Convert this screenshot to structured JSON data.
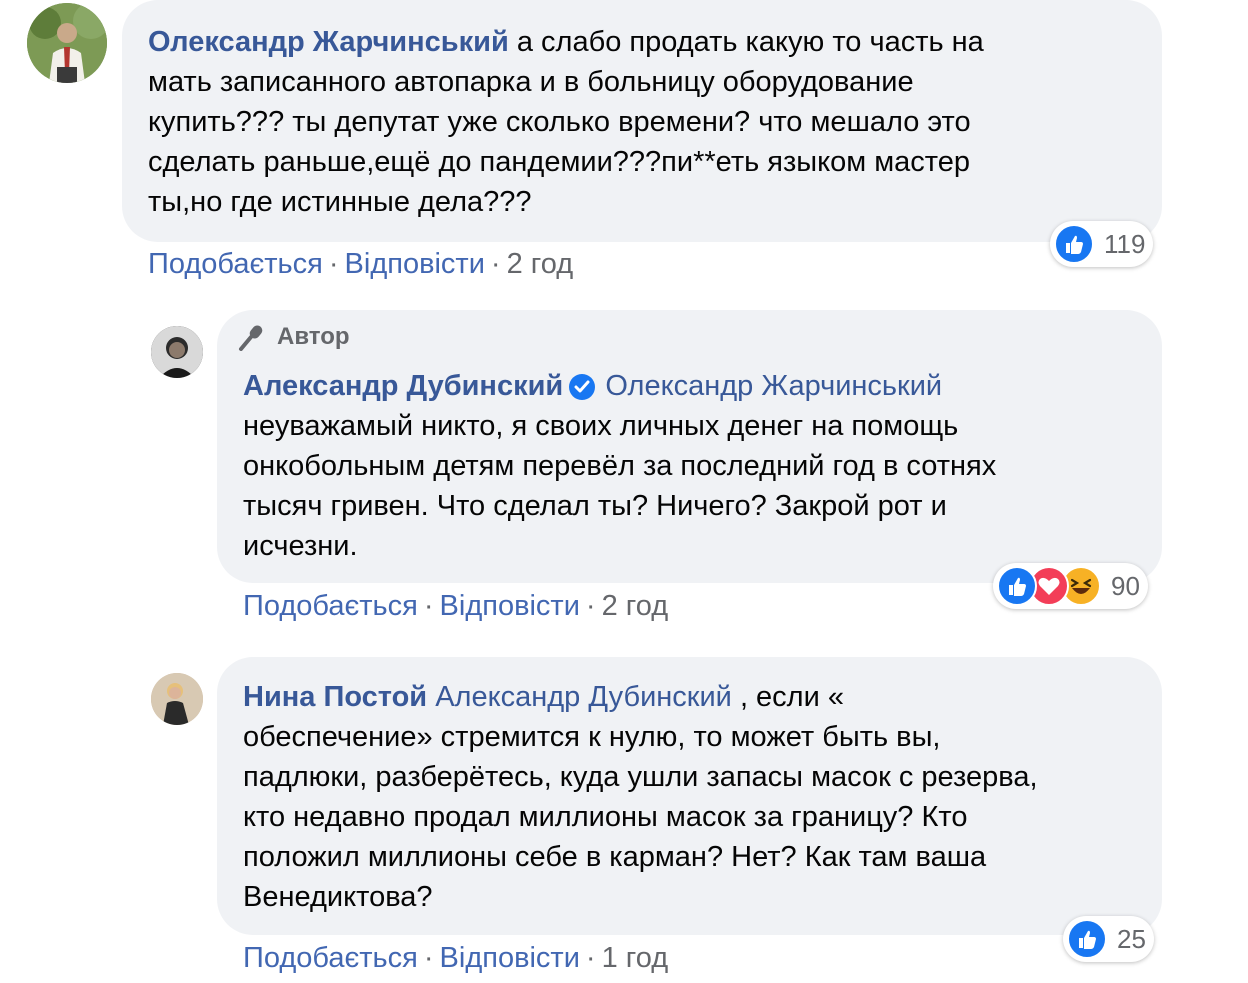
{
  "comments": [
    {
      "author": "Олександр Жарчинський",
      "line1_rest": "а слабо продать какую то часть на",
      "lines": [
        "мать записанного автопарка и в больницу оборудование",
        "купить??? ты депутат уже сколько времени? что мешало это",
        "сделать раньше,ещё до пандемии???пи**еть языком мастер",
        "ты,но где истинные дела???"
      ],
      "like_label": "Подобається",
      "reply_label": "Відповісти",
      "time": "2 год",
      "reaction_count": "119"
    },
    {
      "badge": "Автор",
      "author": "Александр Дубинский",
      "mention": "Олександр Жарчинський",
      "lines": [
        "неуважамый никто, я своих личных денег на помощь",
        "онкобольным детям перевёл за последний год в сотнях",
        "тысяч гривен. Что сделал ты? Ничего? Закрой рот и",
        "исчезни."
      ],
      "like_label": "Подобається",
      "reply_label": "Відповісти",
      "time": "2 год",
      "reaction_count": "90"
    },
    {
      "author": "Нина Постой",
      "mention": "Александр Дубинский",
      "line1_rest": ", если «",
      "lines": [
        "обеспечение» стремится к нулю, то может быть вы,",
        "падлюки, разберётесь, куда ушли запасы масок с резерва,",
        "кто недавно продал миллионы масок за границу? Кто",
        "положил миллионы себе в карман? Нет? Как там ваша",
        "Венедиктова?"
      ],
      "like_label": "Подобається",
      "reply_label": "Відповісти",
      "time": "1 год",
      "reaction_count": "25"
    }
  ],
  "colors": {
    "bubble": "#f0f2f5",
    "link": "#385898",
    "action": "#4267b2",
    "muted": "#65676b",
    "like_blue": "#1877f2"
  },
  "separator": "·"
}
